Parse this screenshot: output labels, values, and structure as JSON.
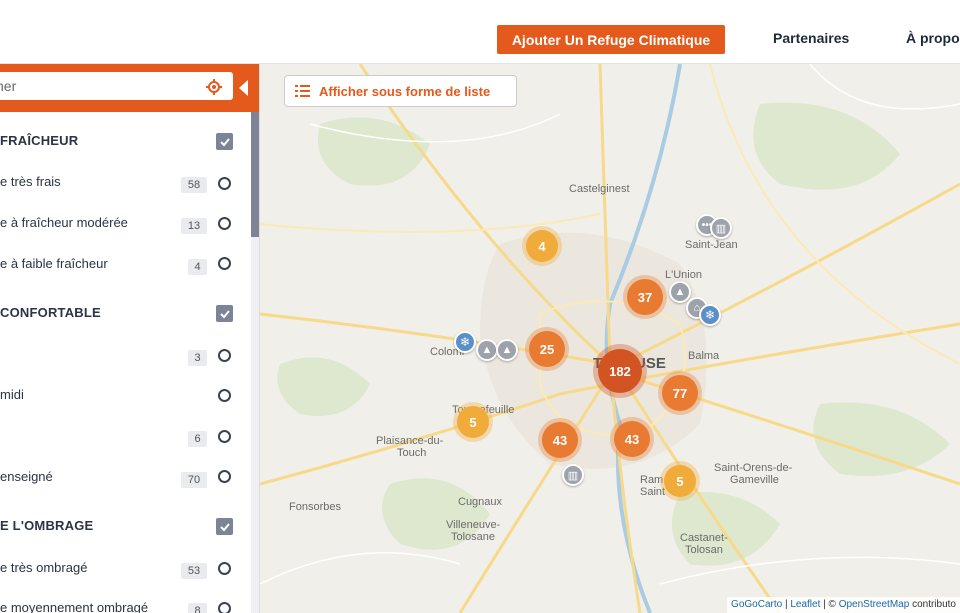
{
  "header": {
    "add_button": "Ajouter Un Refuge Climatique",
    "nav_partners": "Partenaires",
    "nav_about": "À propo"
  },
  "sidebar": {
    "search": {
      "value": "her"
    },
    "categories": [
      {
        "title": "FRAÎCHEUR",
        "options": [
          {
            "label": "e très frais",
            "count": "58"
          },
          {
            "label": "e à fraîcheur modérée",
            "count": "13"
          },
          {
            "label": "e à faible fraîcheur",
            "count": "4"
          }
        ]
      },
      {
        "title": "CONFORTABLE",
        "options": [
          {
            "label": "",
            "count": "3"
          },
          {
            "label": "midi",
            "count": ""
          },
          {
            "label": "",
            "count": "6"
          },
          {
            "label": "enseigné",
            "count": "70"
          }
        ]
      },
      {
        "title": "E L'OMBRAGE",
        "options": [
          {
            "label": "e très ombragé",
            "count": "53"
          },
          {
            "label": "e moyennement ombragé",
            "count": "8"
          }
        ]
      }
    ]
  },
  "map": {
    "list_button": "Afficher sous forme de liste",
    "places": [
      "Castelginest",
      "Saint-Jean",
      "L'Union",
      "Balma",
      "Colomiers",
      "Toulouse",
      "Tournefeuille",
      "Plaisance-du-Touch",
      "Saint-Orens-de-Gameville",
      "Ramonville-Saint-Agne",
      "Fonsorbes",
      "Cugnaux",
      "Villeneuve-Tolosane",
      "Castanet-Tolosan"
    ],
    "place_labels": {
      "castelginest": "Castelginest",
      "saint_jean": "Saint-Jean",
      "lunion": "L'Union",
      "balma": "Balma",
      "colomiers": "Colomi",
      "toulouse_a": "To",
      "toulouse_b": "USE",
      "tournefeuille": "Tournefeuille",
      "plaisance_1": "Plaisance-du-",
      "plaisance_2": "Touch",
      "saint_orens_1": "Saint-Orens-de-",
      "saint_orens_2": "Gameville",
      "ramonville_1": "Ram",
      "ramonville_2": "Saint",
      "fonsorbes": "Fonsorbes",
      "cugnaux": "Cugnaux",
      "villeneuve_1": "Villeneuve-",
      "villeneuve_2": "Tolosane",
      "castanet_1": "Castanet-",
      "castanet_2": "Tolosan"
    },
    "clusters": [
      {
        "count": "4",
        "color": "yellow"
      },
      {
        "count": "37",
        "color": "orange"
      },
      {
        "count": "25",
        "color": "orange"
      },
      {
        "count": "182",
        "color": "red"
      },
      {
        "count": "77",
        "color": "orange"
      },
      {
        "count": "5",
        "color": "yellow"
      },
      {
        "count": "43",
        "color": "orange"
      },
      {
        "count": "43",
        "color": "orange"
      },
      {
        "count": "5",
        "color": "yellow"
      }
    ],
    "attribution": {
      "gogocarto": "GoGoCarto",
      "sep1": " | ",
      "leaflet": "Leaflet",
      "sep2": " | © ",
      "osm": "OpenStreetMap",
      "tail": " contributo"
    }
  },
  "colors": {
    "accent": "#e4591c",
    "cluster_orange": "#e87a31",
    "cluster_yellow": "#f0ab3a",
    "cluster_red": "#d25422"
  }
}
